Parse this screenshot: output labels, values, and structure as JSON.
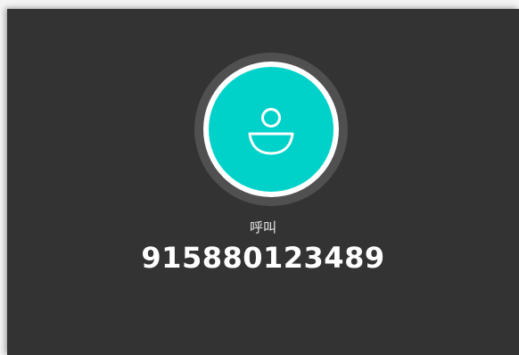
{
  "call": {
    "status_label": "呼叫",
    "number": "915880123489"
  },
  "avatar": {
    "icon": "person-icon"
  },
  "colors": {
    "window_background": "#333333",
    "accent": "#00d1c9",
    "ring": "#505050",
    "text": "#ffffff"
  }
}
